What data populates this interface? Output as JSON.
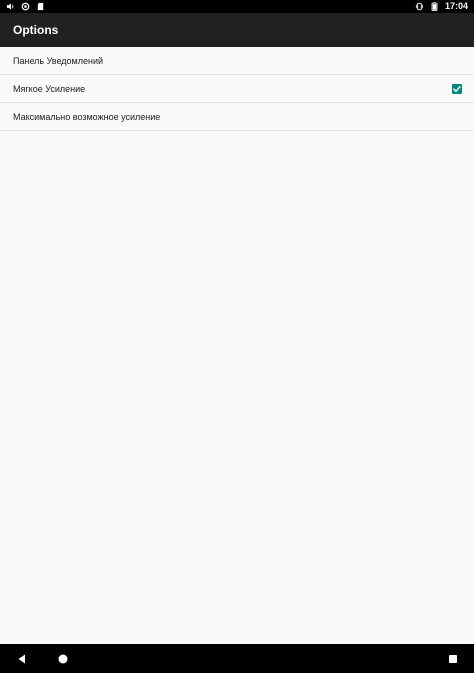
{
  "status_bar": {
    "time": "17:04",
    "icons": [
      "sound-icon",
      "notification-icon",
      "sd-card-icon",
      "vibrate-icon",
      "battery-icon"
    ]
  },
  "app_bar": {
    "title": "Options"
  },
  "settings": {
    "items": [
      {
        "label": "Панель Уведомлений",
        "has_checkbox": false
      },
      {
        "label": "Мягкое Усиление",
        "has_checkbox": true,
        "checked": true
      },
      {
        "label": "Максимально возможное усиление",
        "has_checkbox": false
      }
    ]
  },
  "nav_bar": {
    "buttons": [
      "back-icon",
      "home-icon",
      "recents-icon"
    ]
  },
  "colors": {
    "status_bar": "#000000",
    "app_bar": "#212121",
    "background": "#fafafa",
    "accent": "#00897b",
    "divider": "#e6e6e6"
  }
}
